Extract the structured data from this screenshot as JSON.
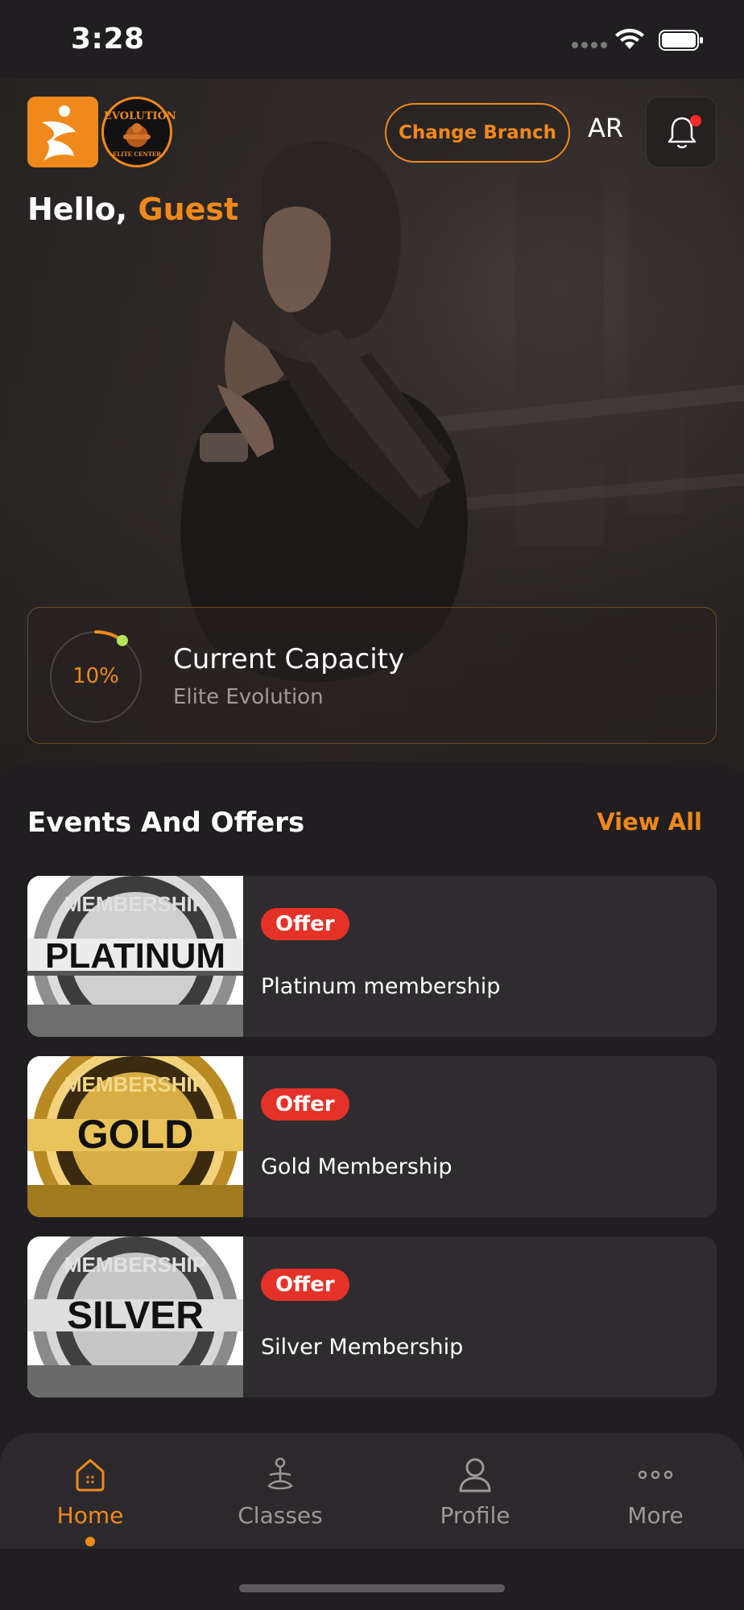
{
  "status_bar": {
    "time": "3:28"
  },
  "header": {
    "change_branch_label": "Change Branch",
    "language_toggle": "AR",
    "brand_logo": "brand-logo",
    "club_logo": "evolution-elite-center-logo",
    "club_logo_line1": "EVOLUTION",
    "club_logo_line2": "ELITE CENTER",
    "bell_icon": "bell-icon",
    "has_notification": true
  },
  "greeting": {
    "prefix": "Hello,",
    "name": "Guest"
  },
  "capacity": {
    "percent_label": "10%",
    "percent": 10,
    "title": "Current Capacity",
    "branch": "Elite Evolution"
  },
  "events": {
    "title": "Events And Offers",
    "view_all_label": "View All",
    "items": [
      {
        "badge": "Offer",
        "name": "Platinum membership",
        "seal_top": "MEMBERSHIP",
        "seal_main": "PLATINUM",
        "tier_color": "#b9b9b9"
      },
      {
        "badge": "Offer",
        "name": "Gold Membership",
        "seal_top": "MEMBERSHIP",
        "seal_main": "GOLD",
        "tier_color": "#d9ad3c"
      },
      {
        "badge": "Offer",
        "name": "Silver Membership",
        "seal_top": "MEMBERSHIP",
        "seal_main": "SILVER",
        "tier_color": "#a9a9a9"
      }
    ]
  },
  "nav": {
    "items": [
      {
        "label": "Home",
        "icon": "home-icon",
        "active": true
      },
      {
        "label": "Classes",
        "icon": "yoga-icon",
        "active": false
      },
      {
        "label": "Profile",
        "icon": "user-icon",
        "active": false
      },
      {
        "label": "More",
        "icon": "more-icon",
        "active": false
      }
    ]
  },
  "colors": {
    "accent": "#f0891b",
    "background": "#201e20",
    "card": "#2e2c2e",
    "offer_badge": "#e53228",
    "gauge_dot": "#b6e35a"
  }
}
